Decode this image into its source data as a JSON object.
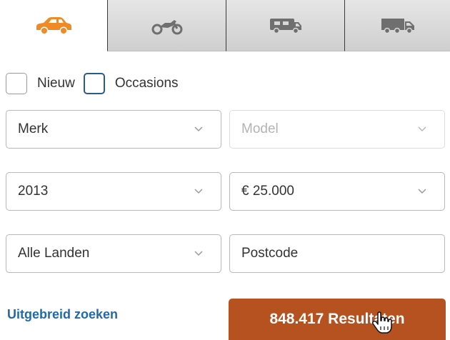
{
  "tabs": [
    {
      "icon": "car-icon",
      "active": true
    },
    {
      "icon": "motorcycle-icon",
      "active": false
    },
    {
      "icon": "camper-icon",
      "active": false
    },
    {
      "icon": "truck-icon",
      "active": false
    }
  ],
  "filters": {
    "new_label": "Nieuw",
    "used_label": "Occasions"
  },
  "fields": {
    "make": "Merk",
    "model": "Model",
    "year": "2013",
    "price": "€ 25.000",
    "country": "Alle Landen",
    "postcode_placeholder": "Postcode"
  },
  "actions": {
    "advanced_search": "Uitgebreid zoeken",
    "results": "848.417 Resultaten"
  },
  "colors": {
    "accent_orange": "#f08a24",
    "results_button": "#b5521f",
    "link_blue": "#1f6aa8",
    "icon_gray": "#7a7a7a"
  }
}
